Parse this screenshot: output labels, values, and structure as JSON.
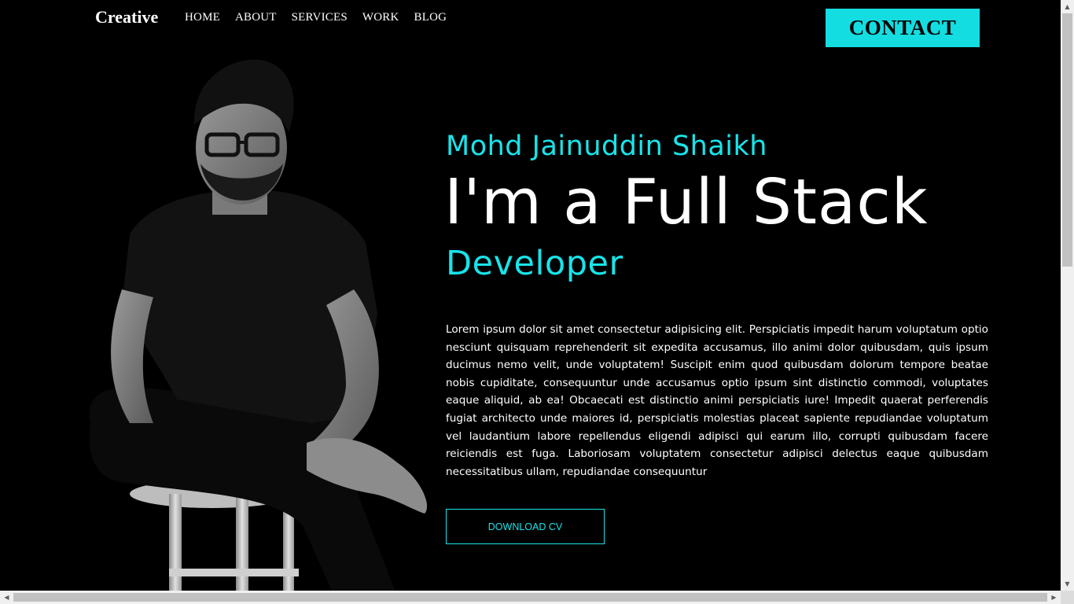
{
  "header": {
    "brand": "Creative",
    "nav": [
      "HOME",
      "ABOUT",
      "SERVICES",
      "WORK",
      "BLOG"
    ],
    "contact_label": "CONTACT"
  },
  "hero": {
    "name": "Mohd Jainuddin Shaikh",
    "title": "I'm a Full Stack",
    "role": "Developer",
    "description": "Lorem ipsum dolor sit amet consectetur adipisicing elit. Perspiciatis impedit harum voluptatum optio nesciunt quisquam reprehenderit sit expedita accusamus, illo animi dolor quibusdam, quis ipsum ducimus nemo velit, unde voluptatem! Suscipit enim quod quibusdam dolorum tempore beatae nobis cupiditate, consequuntur unde accusamus optio ipsum sint distinctio commodi, voluptates eaque aliquid, ab ea! Obcaecati est distinctio animi perspiciatis iure! Impedit quaerat perferendis fugiat architecto unde maiores id, perspiciatis molestias placeat sapiente repudiandae voluptatum vel laudantium labore repellendus eligendi adipisci qui earum illo, corrupti quibusdam facere reiciendis est fuga. Laboriosam voluptatem consectetur adipisci delectus eaque quibusdam necessitatibus ullam, repudiandae consequuntur",
    "cv_label": "DOWNLOAD CV"
  },
  "colors": {
    "accent": "#18e4ea",
    "contact_bg": "#13dde1",
    "background": "#000000"
  },
  "icons": {
    "scroll_up": "arrow-up-icon",
    "scroll_down": "arrow-down-icon",
    "scroll_left": "arrow-left-icon",
    "scroll_right": "arrow-right-icon"
  }
}
